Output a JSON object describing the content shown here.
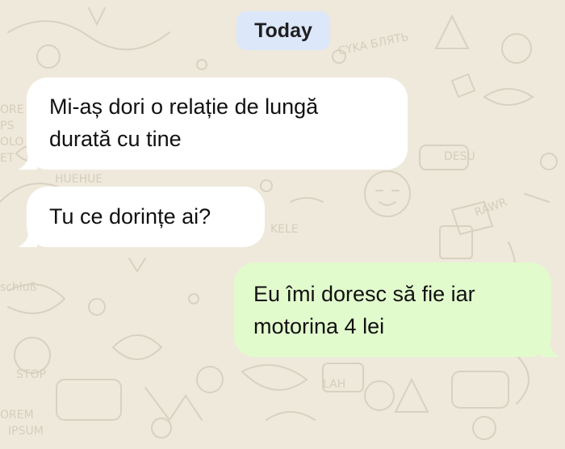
{
  "chat": {
    "date_label": "Today",
    "messages": [
      {
        "direction": "incoming",
        "lines": [
          "Mi-aș dori o relație de lungă",
          "durată cu tine"
        ]
      },
      {
        "direction": "incoming",
        "lines": [
          "Tu ce dorințe ai?"
        ]
      },
      {
        "direction": "outgoing",
        "lines": [
          "Eu îmi doresc să fie iar",
          "motorina 4 lei"
        ]
      }
    ]
  },
  "wallpaper": {
    "doodle_texts": [
      "CYKA БЛЯТЬ",
      "DESU",
      "RAWR",
      "KELE",
      "schluß",
      "STOP",
      "OREM",
      "IPSUM",
      "LAH",
      "HUEHUE",
      "ORE",
      "PS",
      "OLO",
      "ET"
    ]
  },
  "colors": {
    "background": "#efe9dc",
    "doodle_stroke": "#d9d1c0",
    "incoming_bubble": "#ffffff",
    "outgoing_bubble": "#e2fbcd",
    "date_pill": "#dce7fa",
    "text": "#111111"
  }
}
